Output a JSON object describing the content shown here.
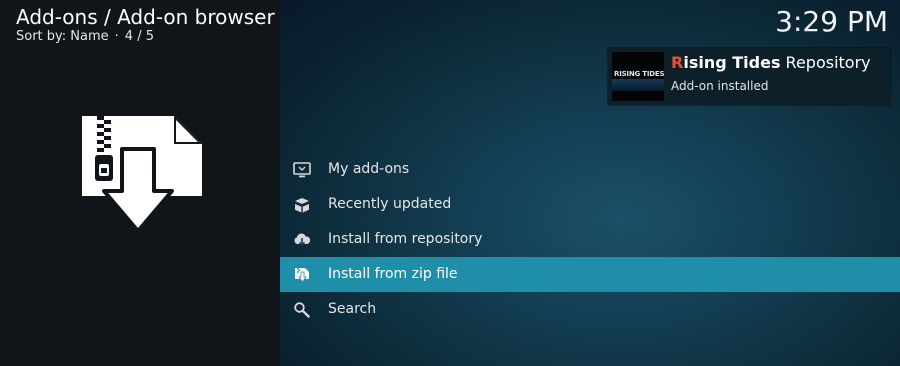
{
  "header": {
    "title": "Add-ons / Add-on browser",
    "sort_label": "Sort by: Name",
    "separator": "·",
    "position": "4 / 5"
  },
  "clock": {
    "time": "3:29 PM"
  },
  "notification": {
    "title_letter_1": "R",
    "title_rest_1": "ising ",
    "title_letter_2": "T",
    "title_rest_2": "ides",
    "title_suffix": " Repository",
    "thumbnail_text": "RISING TIDES",
    "subtitle": "Add-on installed"
  },
  "menu": {
    "items": [
      {
        "label": "My add-ons",
        "icon": "monitor-icon",
        "selected": false
      },
      {
        "label": "Recently updated",
        "icon": "open-box-icon",
        "selected": false
      },
      {
        "label": "Install from repository",
        "icon": "cloud-download-icon",
        "selected": false
      },
      {
        "label": "Install from zip file",
        "icon": "zip-file-icon",
        "selected": true
      },
      {
        "label": "Search",
        "icon": "search-icon",
        "selected": false
      }
    ]
  },
  "illustration": {
    "icon": "zip-install-icon"
  },
  "colors": {
    "selected_bg": "#1f8fa9",
    "accent_letter": "#e8503a",
    "left_panel_bg": "#111418"
  }
}
